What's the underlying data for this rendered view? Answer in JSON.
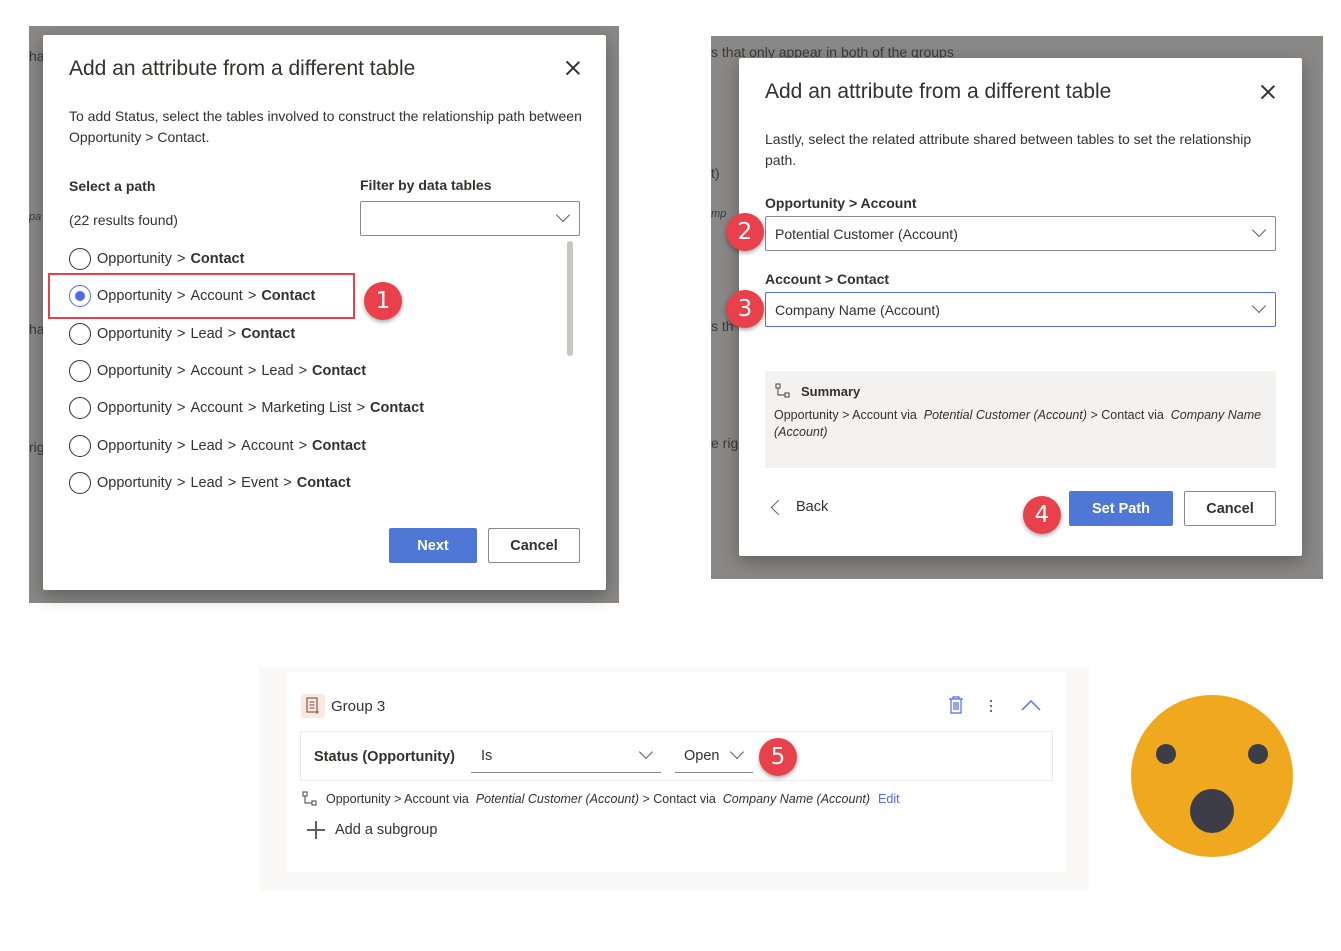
{
  "dialog1": {
    "title": "Add an attribute from a different table",
    "description": "To add Status, select the tables involved to construct the relationship path between Opportunity > Contact.",
    "select_path_label": "Select a path",
    "results_count": "(22 results found)",
    "filter_label": "Filter by data tables",
    "filter_value": "",
    "paths": [
      {
        "segments": [
          "Opportunity",
          "Contact"
        ],
        "selected": false
      },
      {
        "segments": [
          "Opportunity",
          "Account",
          "Contact"
        ],
        "selected": true
      },
      {
        "segments": [
          "Opportunity",
          "Lead",
          "Contact"
        ],
        "selected": false
      },
      {
        "segments": [
          "Opportunity",
          "Account",
          "Lead",
          "Contact"
        ],
        "selected": false
      },
      {
        "segments": [
          "Opportunity",
          "Account",
          "Marketing List",
          "Contact"
        ],
        "selected": false
      },
      {
        "segments": [
          "Opportunity",
          "Lead",
          "Account",
          "Contact"
        ],
        "selected": false
      },
      {
        "segments": [
          "Opportunity",
          "Lead",
          "Event",
          "Contact"
        ],
        "selected": false
      }
    ],
    "next_label": "Next",
    "cancel_label": "Cancel",
    "background_fragments": [
      "ha",
      "pa",
      "ha",
      "rig"
    ]
  },
  "dialog2": {
    "title": "Add an attribute from a different table",
    "description": "Lastly, select the related attribute shared between tables to set the relationship path.",
    "field1_label": "Opportunity > Account",
    "field1_value": "Potential Customer (Account)",
    "field2_label": "Account > Contact",
    "field2_value": "Company Name (Account)",
    "summary_title": "Summary",
    "summary_parts": [
      "Opportunity > Account via",
      "Potential Customer (Account)",
      "> Contact via",
      "Company Name (Account)"
    ],
    "back_label": "Back",
    "set_path_label": "Set Path",
    "cancel_label": "Cancel",
    "background_fragments": [
      "s that only appear in both of the groups",
      "t)",
      "mp",
      "s th",
      "e rig"
    ]
  },
  "group": {
    "title": "Group 3",
    "condition_label": "Status (Opportunity)",
    "operator_value": "Is",
    "value_value": "Open",
    "path_parts": [
      "Opportunity > Account via",
      "Potential Customer (Account)",
      "> Contact via",
      "Company Name (Account)"
    ],
    "edit_label": "Edit",
    "add_subgroup_label": "Add a subgroup"
  },
  "badges": [
    "1",
    "2",
    "3",
    "4",
    "5"
  ],
  "colors": {
    "accent": "#4f77d6",
    "radio_selected": "#4f6bed",
    "highlight": "#e8414b",
    "badge": "#e8414b",
    "emoji_face": "#f0a91f"
  },
  "icons": {
    "close": "close-icon",
    "chevron": "chevron-down-icon",
    "summary": "relationship-icon",
    "group": "group-icon",
    "delete": "trash-icon",
    "more": "more-icon",
    "collapse": "chevron-up-icon",
    "add": "plus-icon",
    "back": "chevron-left-icon"
  }
}
